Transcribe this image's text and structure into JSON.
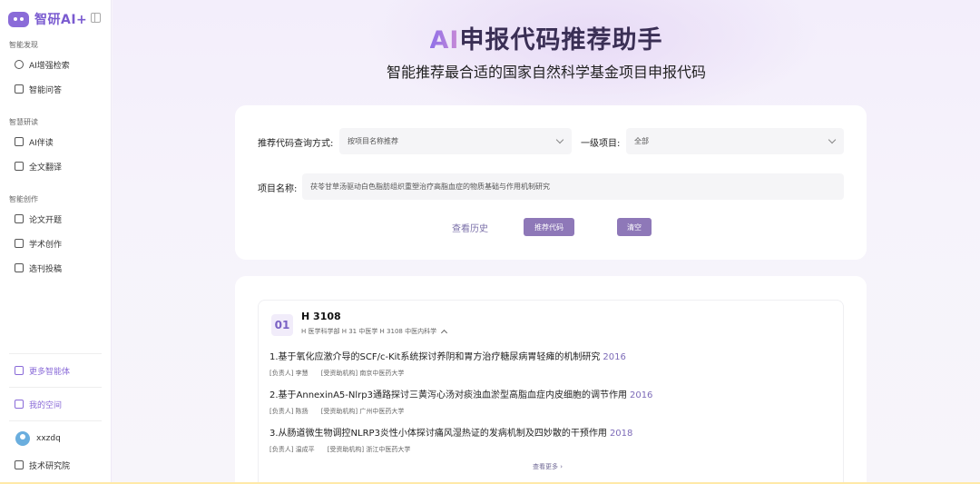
{
  "app": {
    "logo_text": "智研AI+"
  },
  "sidebar": {
    "sections": [
      {
        "label": "智能发现",
        "items": [
          {
            "label": "AI增强检索",
            "icon": "search-doc-icon"
          },
          {
            "label": "智能问答",
            "icon": "chat-icon"
          }
        ]
      },
      {
        "label": "智慧研读",
        "items": [
          {
            "label": "AI伴读",
            "icon": "reader-icon"
          },
          {
            "label": "全文翻译",
            "icon": "translate-icon"
          }
        ]
      },
      {
        "label": "智能创作",
        "items": [
          {
            "label": "论文开题",
            "icon": "edit-doc-icon"
          },
          {
            "label": "学术创作",
            "icon": "pen-icon"
          },
          {
            "label": "选刊投稿",
            "icon": "journal-icon"
          }
        ]
      }
    ],
    "more_agents": "更多智能体",
    "my_space": "我的空间",
    "user_name": "xxzdq",
    "institute": "技术研究院"
  },
  "hero": {
    "title_ai": "AI",
    "title_rest": "申报代码推荐助手",
    "subtitle": "智能推荐最合适的国家自然科学基金项目申报代码"
  },
  "form": {
    "query_label": "推荐代码查询方式:",
    "query_value": "按项目名称推荐",
    "level_label": "一级项目:",
    "level_value": "全部",
    "project_label": "项目名称:",
    "project_value": "茯苓甘草汤驱动白色脂肪组织重塑治疗高脂血症的物质基础与作用机制研究",
    "history_label": "查看历史",
    "recommend_label": "推荐代码",
    "clear_label": "清空"
  },
  "result": {
    "rank": "01",
    "code": "H 3108",
    "path": "H 医学科学部  H 31 中医学  H 3108 中医内科学",
    "projects": [
      {
        "title": "1.基于氧化应激介导的SCF/c-Kit系统探讨养阴和胃方治疗糖尿病胃轻瘫的机制研究",
        "year": "2016",
        "leader": "[负责人] 李慧",
        "org": "[受资助机构] 南京中医药大学"
      },
      {
        "title": "2.基于AnnexinA5-Nlrp3通路探讨三黄泻心汤对痰浊血淤型高脂血症内皮细胞的调节作用",
        "year": "2016",
        "leader": "[负责人] 陈扬",
        "org": "[受资助机构] 广州中医药大学"
      },
      {
        "title": "3.从肠道微生物调控NLRP3炎性小体探讨痛风湿热证的发病机制及四妙散的干预作用",
        "year": "2018",
        "leader": "[负责人] 温成平",
        "org": "[受资助机构] 浙江中医药大学"
      }
    ],
    "more_label": "查看更多 ›"
  },
  "colors": {
    "accent": "#8a6bd8",
    "button": "#8e78b8"
  }
}
